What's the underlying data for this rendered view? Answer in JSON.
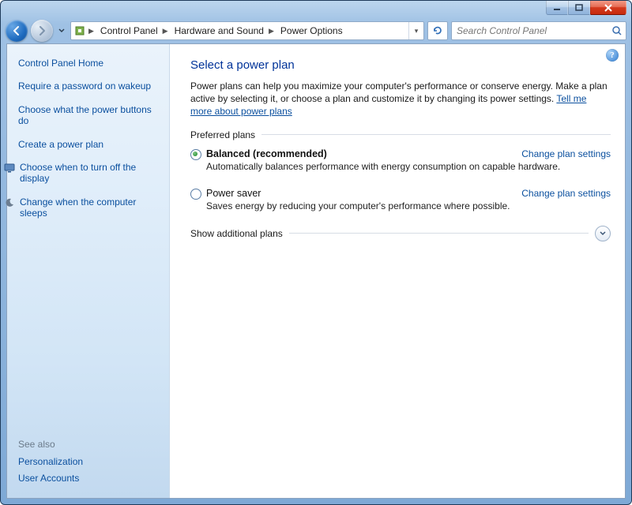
{
  "breadcrumb": {
    "items": [
      "Control Panel",
      "Hardware and Sound",
      "Power Options"
    ]
  },
  "search": {
    "placeholder": "Search Control Panel"
  },
  "sidebar": {
    "home": "Control Panel Home",
    "links": [
      "Require a password on wakeup",
      "Choose what the power buttons do",
      "Create a power plan",
      "Choose when to turn off the display",
      "Change when the computer sleeps"
    ],
    "see_also_label": "See also",
    "see_also": [
      "Personalization",
      "User Accounts"
    ]
  },
  "main": {
    "title": "Select a power plan",
    "description": "Power plans can help you maximize your computer's performance or conserve energy. Make a plan active by selecting it, or choose a plan and customize it by changing its power settings. ",
    "description_link": "Tell me more about power plans",
    "preferred_label": "Preferred plans",
    "plans": [
      {
        "name": "Balanced (recommended)",
        "selected": true,
        "change_label": "Change plan settings",
        "sub": "Automatically balances performance with energy consumption on capable hardware."
      },
      {
        "name": "Power saver",
        "selected": false,
        "change_label": "Change plan settings",
        "sub": "Saves energy by reducing your computer's performance where possible."
      }
    ],
    "additional_label": "Show additional plans"
  },
  "help_tooltip": "?"
}
